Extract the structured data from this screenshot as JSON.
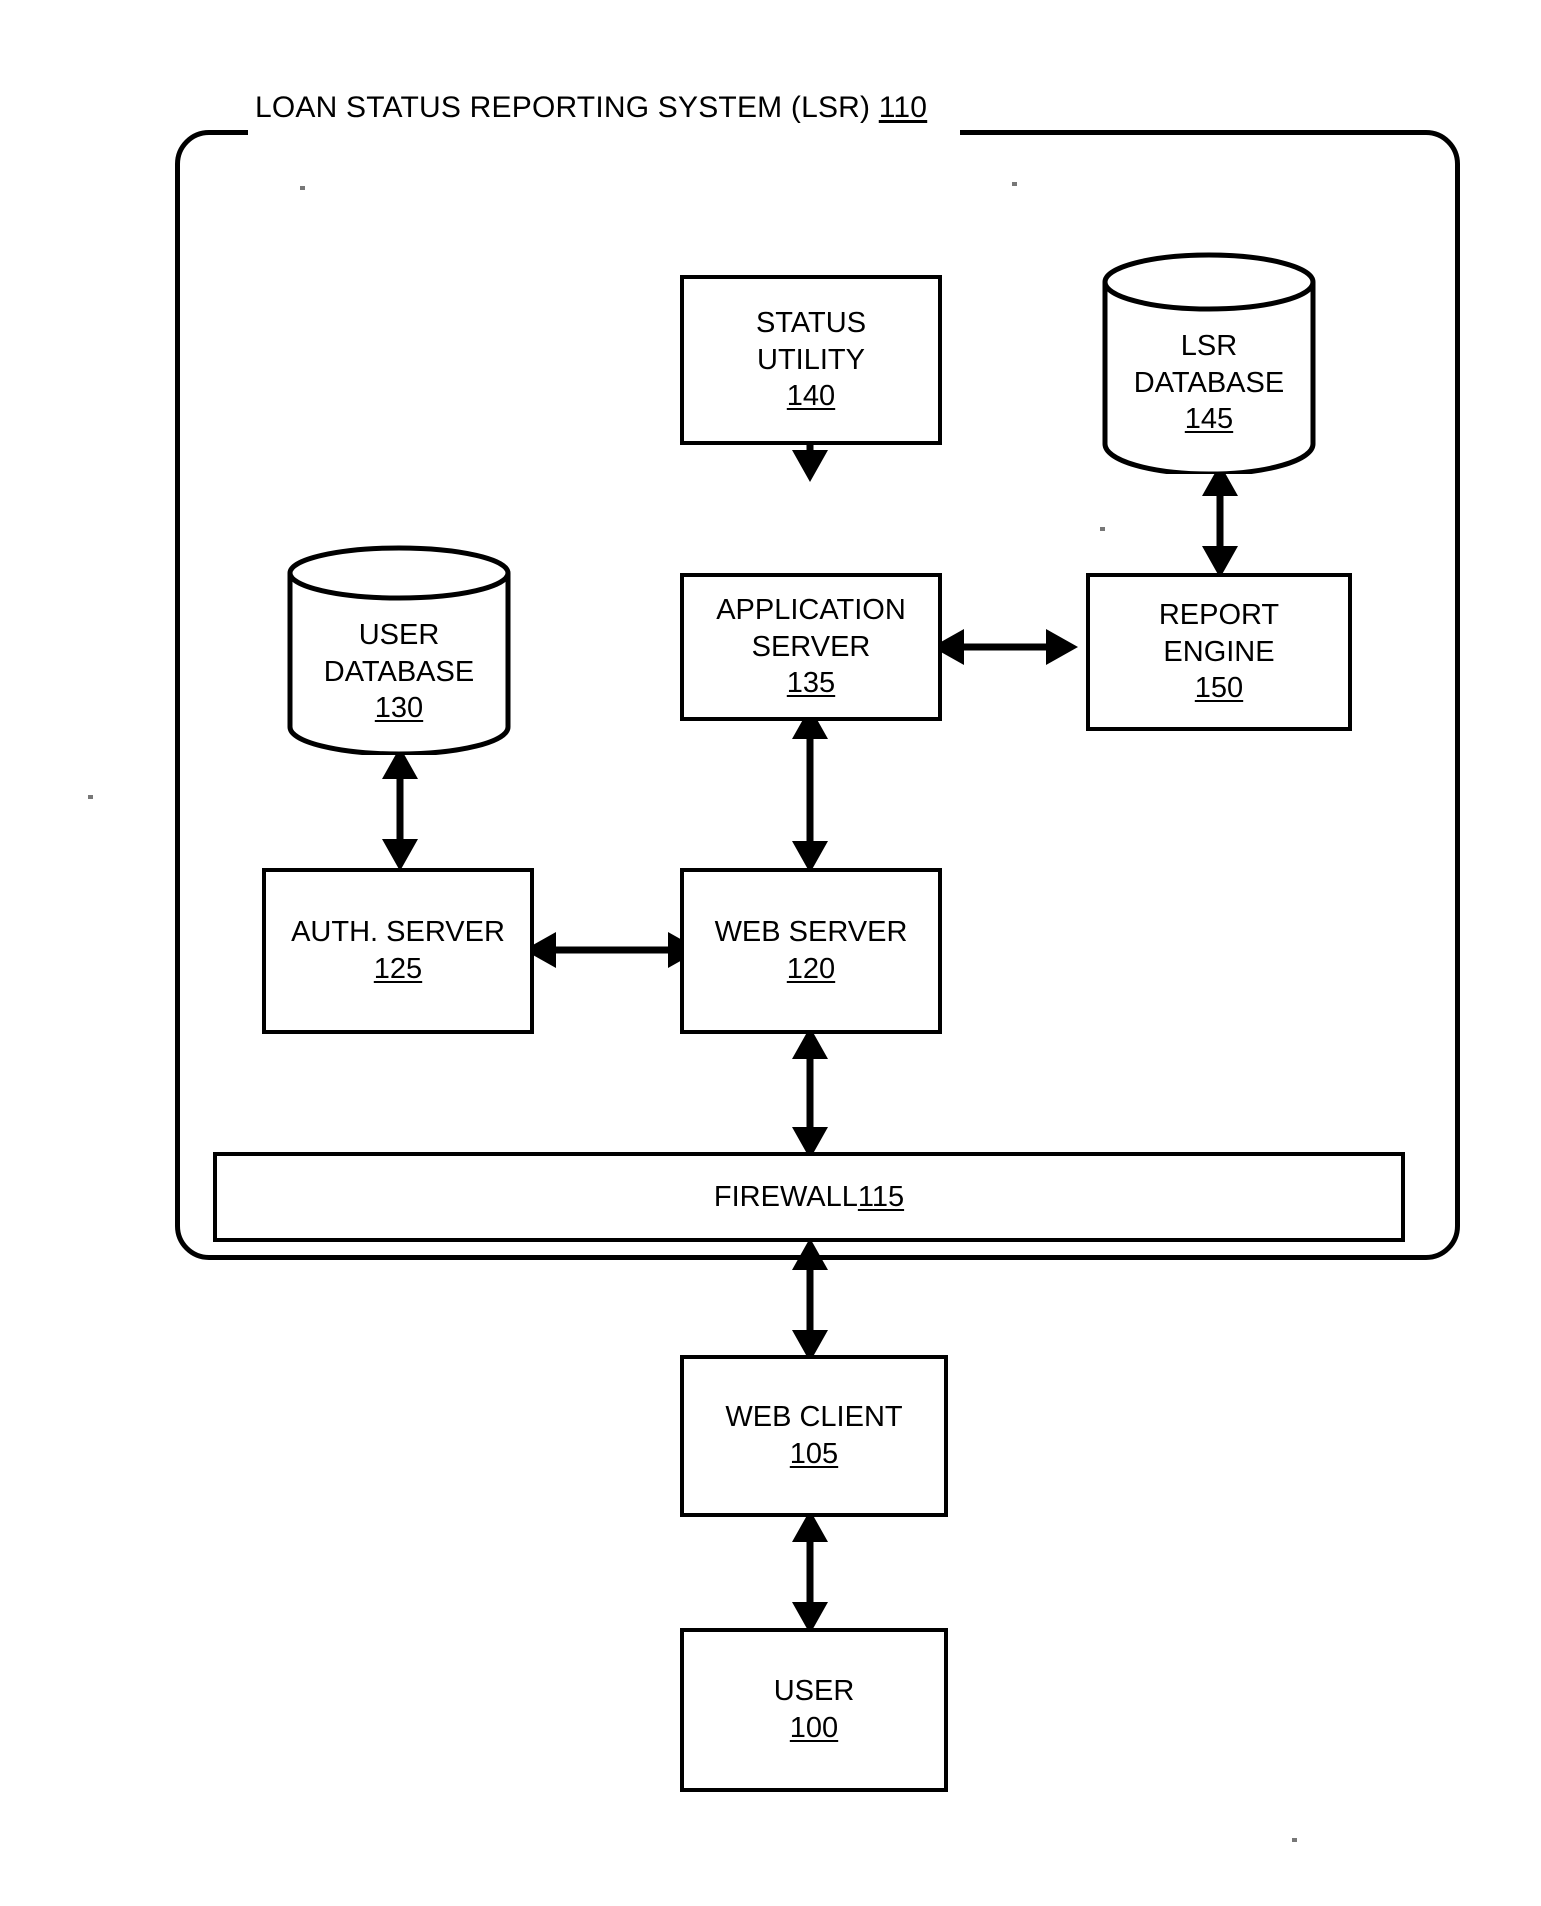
{
  "diagram": {
    "title_text": "LOAN STATUS REPORTING SYSTEM  (LSR) ",
    "title_ref": "110",
    "nodes": {
      "status_utility": {
        "label": "STATUS",
        "label2": "UTILITY",
        "ref": "140",
        "shape": "box"
      },
      "lsr_database": {
        "label": "LSR",
        "label2": "DATABASE",
        "ref": "145",
        "shape": "cylinder"
      },
      "user_database": {
        "label": "USER",
        "label2": "DATABASE",
        "ref": "130",
        "shape": "cylinder"
      },
      "application_server": {
        "label": "APPLICATION",
        "label2": "SERVER",
        "ref": "135",
        "shape": "box"
      },
      "report_engine": {
        "label": "REPORT",
        "label2": "ENGINE",
        "ref": "150",
        "shape": "box"
      },
      "auth_server": {
        "label": "AUTH. SERVER",
        "label2": "",
        "ref": "125",
        "shape": "box"
      },
      "web_server": {
        "label": "WEB SERVER",
        "label2": "",
        "ref": "120",
        "shape": "box"
      },
      "firewall": {
        "label": "FIREWALL ",
        "label2": "",
        "ref": "115",
        "shape": "bar"
      },
      "web_client": {
        "label": "WEB CLIENT",
        "label2": "",
        "ref": "105",
        "shape": "box"
      },
      "user": {
        "label": "USER",
        "label2": "",
        "ref": "100",
        "shape": "box"
      }
    },
    "connections": [
      {
        "from": "status_utility",
        "to": "lsr_database",
        "type": "bidirectional",
        "orientation": "horizontal"
      },
      {
        "from": "status_utility",
        "to": "application_server",
        "type": "bidirectional",
        "orientation": "vertical"
      },
      {
        "from": "application_server",
        "to": "report_engine",
        "type": "bidirectional",
        "orientation": "horizontal"
      },
      {
        "from": "report_engine",
        "to": "lsr_database",
        "type": "bidirectional",
        "orientation": "vertical"
      },
      {
        "from": "user_database",
        "to": "auth_server",
        "type": "bidirectional",
        "orientation": "vertical"
      },
      {
        "from": "auth_server",
        "to": "web_server",
        "type": "bidirectional",
        "orientation": "horizontal"
      },
      {
        "from": "application_server",
        "to": "web_server",
        "type": "bidirectional",
        "orientation": "vertical"
      },
      {
        "from": "web_server",
        "to": "firewall",
        "type": "bidirectional",
        "orientation": "vertical"
      },
      {
        "from": "firewall",
        "to": "web_client",
        "type": "bidirectional",
        "orientation": "vertical"
      },
      {
        "from": "web_client",
        "to": "user",
        "type": "bidirectional",
        "orientation": "vertical"
      }
    ],
    "colors": {
      "stroke": "#000000",
      "background": "#ffffff"
    }
  }
}
